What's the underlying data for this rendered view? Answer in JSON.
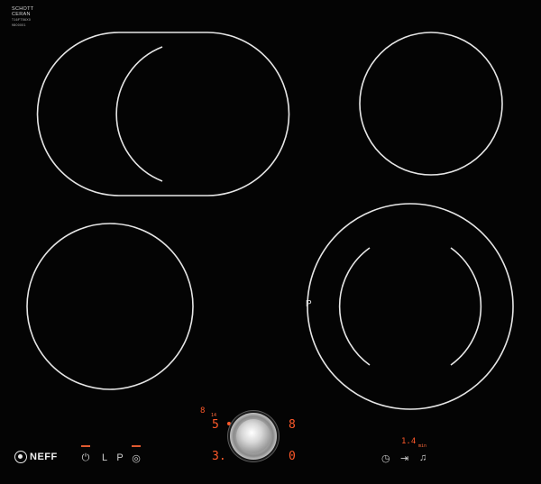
{
  "brand": {
    "glass_maker_line1": "SCHOTT",
    "glass_maker_line2": "CERAN",
    "model_code": "T16FT56X0",
    "serial_code": "9800001",
    "logo_word": "NEFF"
  },
  "zone_marker": "P",
  "controls_left": [
    {
      "name": "power-button",
      "symbol": "⏻",
      "icon": "power-icon"
    },
    {
      "name": "lock-button",
      "symbol": "L",
      "icon": "child-lock-icon"
    },
    {
      "name": "powerboost-button",
      "symbol": "P",
      "icon": "power-boost-icon"
    },
    {
      "name": "settings-button",
      "symbol": "◎",
      "icon": "settings-icon"
    }
  ],
  "twistpad": {
    "zone_display_top_left": "5",
    "zone_display_top_right": "8",
    "zone_display_bottom_left": "3.",
    "zone_display_bottom_right": "0",
    "indicator_top": "8",
    "indicator_top_small": "14"
  },
  "timer": {
    "value": "1.4",
    "unit": "min",
    "controls": [
      {
        "name": "timer-clock-button",
        "symbol": "◷",
        "icon": "clock-icon"
      },
      {
        "name": "timer-skip-button",
        "symbol": "⇥",
        "icon": "skip-icon"
      },
      {
        "name": "timer-alarm-button",
        "symbol": "♫",
        "icon": "bell-icon"
      }
    ]
  },
  "colors": {
    "glass": "#040404",
    "zone_outline": "#e8e8e8",
    "display_led": "#ff5a2a"
  }
}
